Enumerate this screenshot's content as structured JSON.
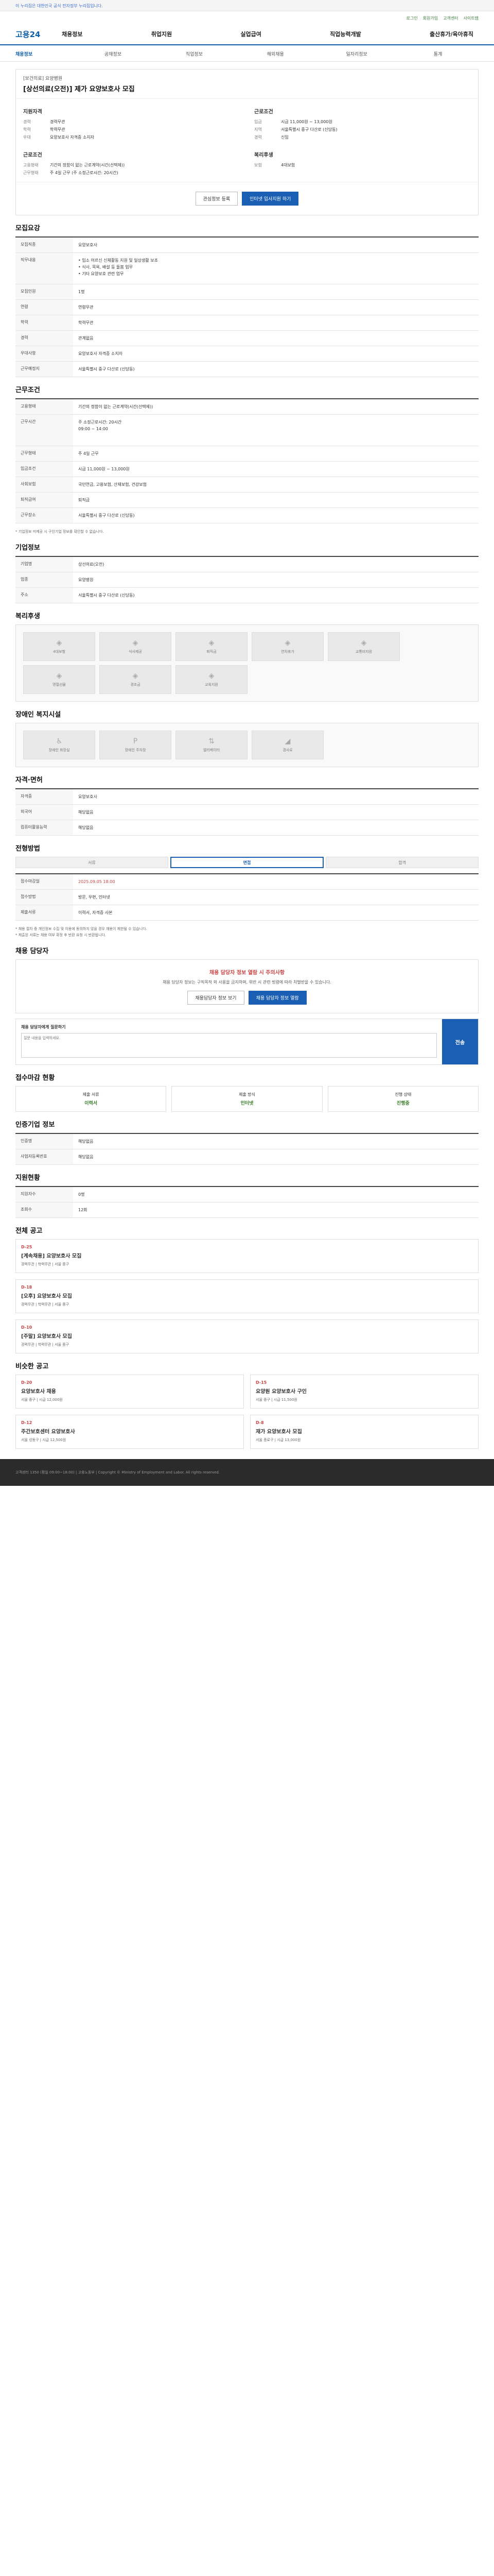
{
  "topbar": {
    "gov": "이 누리집은 대한민국 공식 전자정부 누리집입니다.",
    "note": ""
  },
  "util": [
    "로그인",
    "회원가입",
    "고객센터",
    "사이트맵"
  ],
  "logo": "고용24",
  "gnb": [
    "채용정보",
    "취업지원",
    "실업급여",
    "직업능력개발",
    "출산휴가/육아휴직"
  ],
  "lnb": [
    "채용정보",
    "공채정보",
    "직업정보",
    "해외채용",
    "일자리정보",
    "통계"
  ],
  "head": {
    "co": "[보건의료] 요양병원",
    "title": "[상선의료(오전)] 제가 요양보호사 모집",
    "left_title": "지원자격",
    "left": [
      [
        "경력",
        "경력무관"
      ],
      [
        "학력",
        "학력무관"
      ],
      [
        "우대",
        "요양보호사 자격증 소지자"
      ]
    ],
    "left2_title": "근로조건",
    "left2": [
      [
        "고용형태",
        "기간의 정함이 없는 근로계약(시간(선택제))"
      ],
      [
        "근무형태",
        "주 4일 근무 (주 소정근로시간: 20시간)"
      ]
    ],
    "right_title": "근로조건",
    "right": [
      [
        "임금",
        "시급 11,000원 ~ 13,000원"
      ],
      [
        "지역",
        "서울특별시 중구 다산로 (신당동)"
      ],
      [
        "경력",
        "신입"
      ]
    ],
    "right2_title": "복리후생",
    "right2": [
      [
        "보험",
        "4대보험"
      ]
    ],
    "btn_like": "관심정보 등록",
    "btn_apply": "인터넷 입사지원 하기"
  },
  "s1": {
    "title": "모집요강",
    "rows": [
      [
        "모집직종",
        "요양보호사"
      ],
      [
        "직무내용",
        "• 입소 어르신 신체활동 지원 및 일상생활 보조\n• 식사, 목욕, 배설 등 돌봄 업무\n• 기타 요양보호 관련 업무"
      ],
      [
        "모집인원",
        "1명"
      ],
      [
        "연령",
        "연령무관"
      ],
      [
        "학력",
        "학력무관"
      ],
      [
        "경력",
        "관계없음"
      ],
      [
        "우대사항",
        "요양보호사 자격증 소지자"
      ],
      [
        "근무예정지",
        "서울특별시 중구 다산로 (신당동)"
      ]
    ]
  },
  "s2": {
    "title": "근무조건",
    "rows": [
      [
        "고용형태",
        "기간의 정함이 없는 근로계약(시간(선택제))"
      ],
      [
        "근무시간",
        "주 소정근로시간: 20시간\n09:00 ~ 14:00"
      ],
      [
        "근무형태",
        "주 4일 근무"
      ],
      [
        "임금조건",
        "시급 11,000원 ~ 13,000원"
      ],
      [
        "사회보험",
        "국민연금, 고용보험, 산재보험, 건강보험"
      ],
      [
        "퇴직급여",
        "퇴직금"
      ],
      [
        "근무장소",
        "서울특별시 중구 다산로 (신당동)"
      ]
    ],
    "note": "* 기업정보 미제공 시 구인기업 정보를 확인할 수 없습니다."
  },
  "s3": {
    "title": "기업정보",
    "rows": [
      [
        "기업명",
        "상선의료(오전)"
      ],
      [
        "업종",
        "요양병원"
      ],
      [
        "주소",
        "서울특별시 중구 다산로 (신당동)"
      ]
    ]
  },
  "s4": {
    "title": "복리후생",
    "facs": [
      "4대보험",
      "식사제공",
      "퇴직금",
      "연차휴가",
      "교통비지원",
      "명절선물",
      "경조금",
      "교육지원"
    ]
  },
  "s5": {
    "title": "장애인 복지시설",
    "facs": [
      "장애인 화장실",
      "장애인 주차장",
      "엘리베이터",
      "경사로"
    ]
  },
  "s6": {
    "title": "자격·면허",
    "rows": [
      [
        "자격증",
        "요양보호사"
      ],
      [
        "외국어",
        "해당없음"
      ],
      [
        "컴퓨터활용능력",
        "해당없음"
      ]
    ]
  },
  "s7": {
    "title": "전형방법",
    "steps": [
      "서류",
      "면접",
      "합격"
    ],
    "rows": [
      [
        "접수마감일",
        "2025.09.05 18:00"
      ],
      [
        "접수방법",
        "방문, 우편, 인터넷"
      ],
      [
        "제출서류",
        "이력서, 자격증 사본"
      ]
    ],
    "notes": "* 채용 절차 중 개인정보 수집 및 이용에 동의하지 않을 경우 채용이 제한될 수 있습니다.\n* 제출된 서류는 채용 여부 확정 후 반환 요청 시 반환됩니다."
  },
  "s8": {
    "title": "채용 담당자",
    "warn": "채용 담당자 정보 열람 시 주의사항",
    "p": "채용 담당자 정보는 구직목적 외 사용을 금지하며, 위반 시 관련 법령에 따라 처벌받을 수 있습니다.",
    "b1": "채용담당자 정보 보기",
    "b2": "채용 담당자 정보 열람",
    "q_title": "채용 담당자에게 질문하기",
    "q_ph": "질문 내용을 입력하세요.",
    "send": "전송"
  },
  "s9": {
    "title": "접수마감 현황",
    "items": [
      [
        "제출 서류",
        "이력서"
      ],
      [
        "제출 방식",
        "인터넷"
      ],
      [
        "진행 상태",
        "진행중"
      ]
    ]
  },
  "s10": {
    "title": "인증기업 정보",
    "rows": [
      [
        "인증명",
        "해당없음"
      ],
      [
        "사업자등록번호",
        "해당없음"
      ]
    ]
  },
  "s11": {
    "title": "지원현황",
    "rows": [
      [
        "지원자수",
        "0명"
      ],
      [
        "조회수",
        "12회"
      ]
    ]
  },
  "s12": {
    "title": "전체 공고",
    "cards": [
      {
        "d": "D-25",
        "t": "[계속채용] 요양보호사 모집",
        "m": "경력무관 | 학력무관 | 서울 중구"
      },
      {
        "d": "D-18",
        "t": "[오후] 요양보호사 모집",
        "m": "경력무관 | 학력무관 | 서울 중구"
      },
      {
        "d": "D-10",
        "t": "[주말] 요양보호사 모집",
        "m": "경력무관 | 학력무관 | 서울 중구"
      }
    ]
  },
  "s13": {
    "title": "비슷한 공고",
    "cards": [
      {
        "d": "D-20",
        "t": "요양보호사 채용",
        "m": "서울 중구 | 시급 12,000원"
      },
      {
        "d": "D-15",
        "t": "요양원 요양보호사 구인",
        "m": "서울 중구 | 시급 11,500원"
      },
      {
        "d": "D-12",
        "t": "주간보호센터 요양보호사",
        "m": "서울 성동구 | 시급 12,500원"
      },
      {
        "d": "D-8",
        "t": "재가 요양보호사 모집",
        "m": "서울 종로구 | 시급 13,000원"
      }
    ]
  },
  "footer": "고객센터 1350 (평일 09:00~18:00) | 고용노동부 | Copyright © Ministry of Employment and Labor. All rights reserved."
}
